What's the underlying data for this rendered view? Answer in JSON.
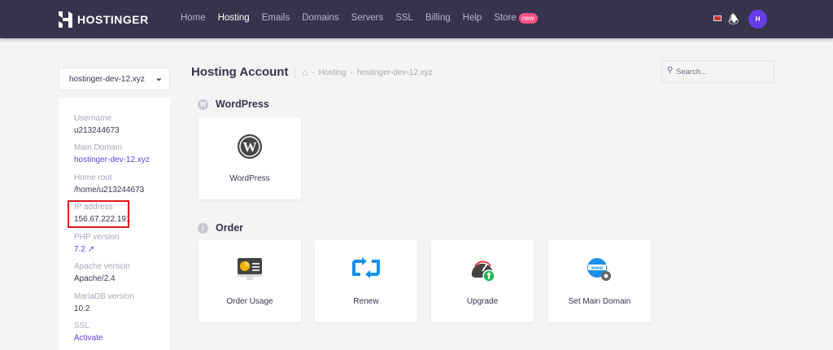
{
  "header": {
    "brand": "HOSTINGER",
    "nav": [
      "Home",
      "Hosting",
      "Emails",
      "Domains",
      "Servers",
      "SSL",
      "Billing",
      "Help",
      "Store"
    ],
    "active": "Hosting",
    "store_badge": "new",
    "avatar": "H"
  },
  "domain_select": "hostinger-dev-12.xyz",
  "sidebar": [
    {
      "label": "Username",
      "value": "u213244673"
    },
    {
      "label": "Main Domain",
      "value": "hostinger-dev-12.xyz"
    },
    {
      "label": "Home root",
      "value": "/home/u213244673"
    },
    {
      "label": "IP address",
      "value": "156.67.222.191"
    },
    {
      "label": "PHP version",
      "value": "7.2"
    },
    {
      "label": "Apache version",
      "value": "Apache/2.4"
    },
    {
      "label": "MariaDB version",
      "value": "10.2"
    },
    {
      "label": "SSL",
      "value": "Activate"
    }
  ],
  "page_title": "Hosting Account",
  "breadcrumb": [
    "Hosting",
    "hostinger-dev-12.xyz"
  ],
  "search_placeholder": "Search...",
  "sections": {
    "wordpress": {
      "title": "WordPress",
      "cards": [
        "WordPress"
      ]
    },
    "order": {
      "title": "Order",
      "cards": [
        "Order Usage",
        "Renew",
        "Upgrade",
        "Set Main Domain"
      ]
    }
  },
  "colors": {
    "header": "#36344d",
    "accent": "#673de6",
    "highlight": "#e0191f"
  }
}
